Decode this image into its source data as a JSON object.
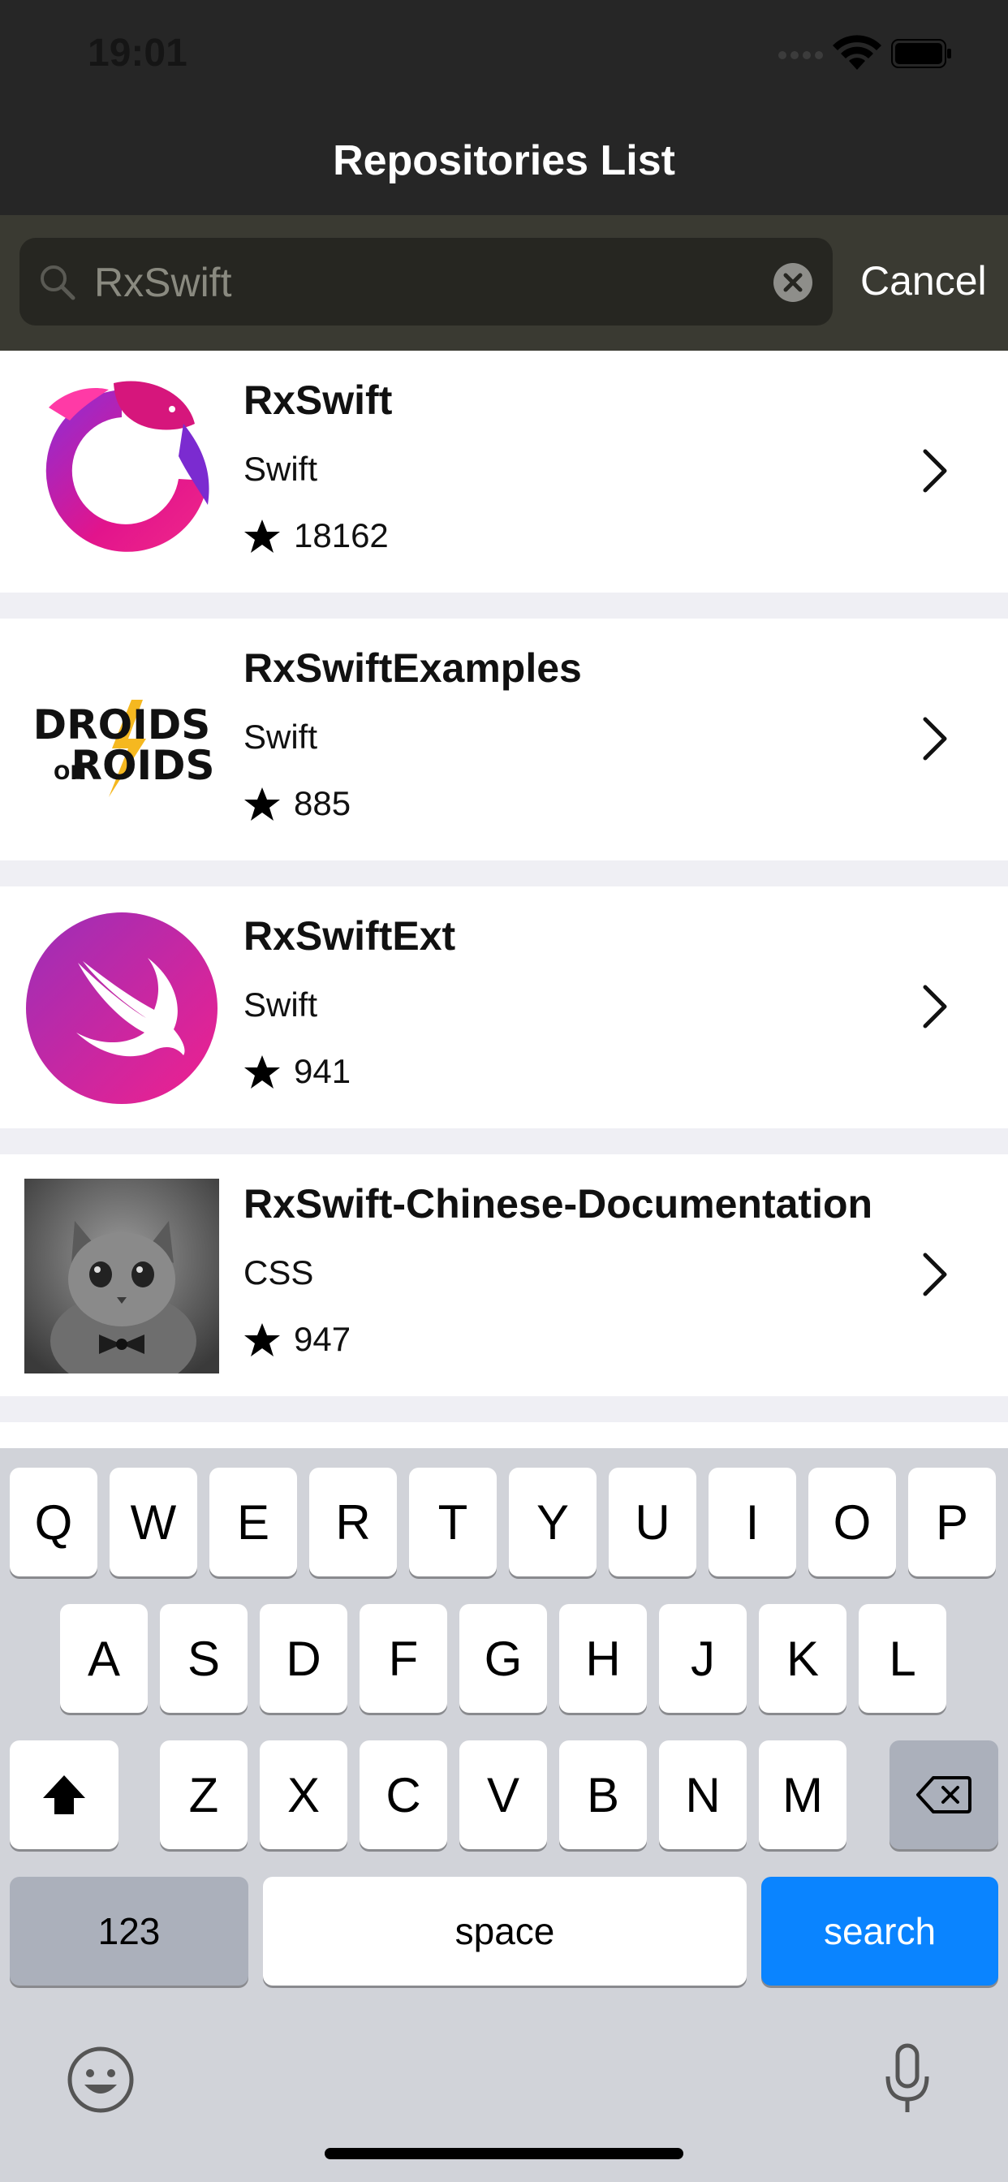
{
  "status_bar": {
    "time": "19:01"
  },
  "navbar": {
    "title": "Repositories List"
  },
  "search": {
    "value": "RxSwift",
    "cancel_label": "Cancel"
  },
  "repositories": [
    {
      "name": "RxSwift",
      "language": "Swift",
      "stars": "18162",
      "avatar": "rxswift-eel-logo"
    },
    {
      "name": "RxSwiftExamples",
      "language": "Swift",
      "stars": "885",
      "avatar": "droids-on-roids-logo",
      "avatar_text": [
        "DROIDS",
        "ON",
        "ROIDS"
      ]
    },
    {
      "name": "RxSwiftExt",
      "language": "Swift",
      "stars": "941",
      "avatar": "swift-bird-logo"
    },
    {
      "name": "RxSwift-Chinese-Documentation",
      "language": "CSS",
      "stars": "947",
      "avatar": "kitten-photo"
    }
  ],
  "keyboard": {
    "row1": [
      "Q",
      "W",
      "E",
      "R",
      "T",
      "Y",
      "U",
      "I",
      "O",
      "P"
    ],
    "row2": [
      "A",
      "S",
      "D",
      "F",
      "G",
      "H",
      "J",
      "K",
      "L"
    ],
    "row3": [
      "Z",
      "X",
      "C",
      "V",
      "B",
      "N",
      "M"
    ],
    "numbers_label": "123",
    "space_label": "space",
    "search_label": "search"
  },
  "colors": {
    "nav_background": "#262626",
    "search_bar_background": "#3a3a32",
    "search_key": "#0a84ff",
    "keyboard_background": "#d1d3d9"
  }
}
